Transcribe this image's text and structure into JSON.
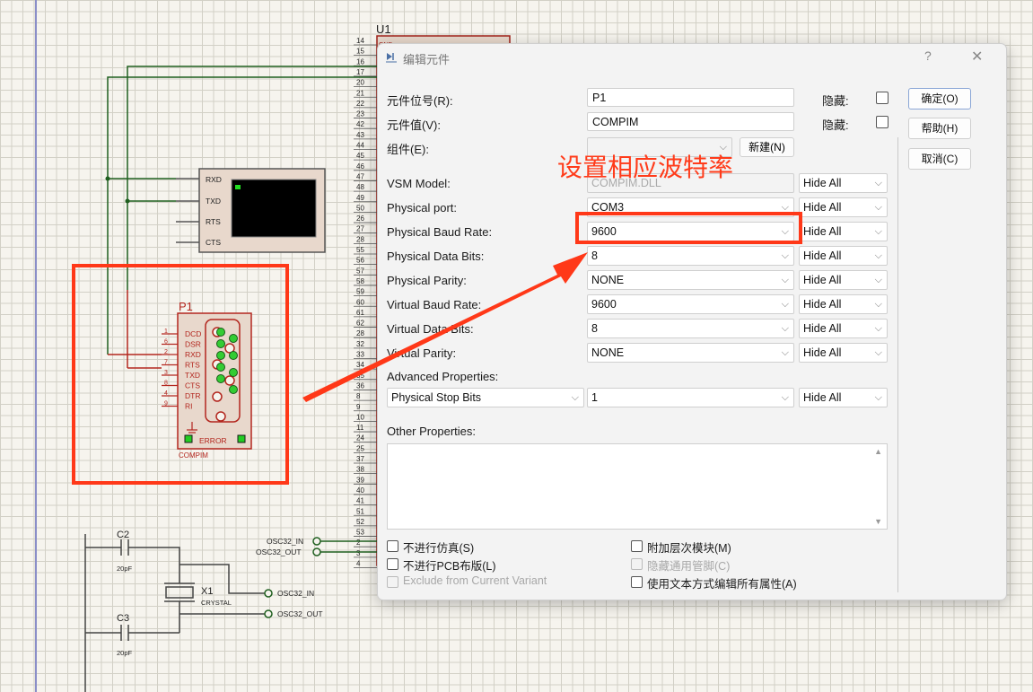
{
  "schematic": {
    "u1_label": "U1",
    "u1_pins": [
      "14",
      "15",
      "16",
      "17",
      "20",
      "21",
      "22",
      "23",
      "42",
      "43",
      "44",
      "45",
      "46",
      "47",
      "48",
      "49",
      "50",
      "26",
      "27",
      "28",
      "55",
      "56",
      "57",
      "58",
      "59",
      "60",
      "61",
      "62",
      "28",
      "32",
      "33",
      "34",
      "35",
      "36",
      "8",
      "9",
      "10",
      "11",
      "24",
      "25",
      "37",
      "38",
      "39",
      "40",
      "41",
      "51",
      "52",
      "53",
      "2",
      "3",
      "4"
    ],
    "u1_top_text": "GND",
    "terminal": {
      "pins": [
        "RXD",
        "TXD",
        "RTS",
        "CTS"
      ]
    },
    "compim": {
      "ref": "P1",
      "pin_nums": [
        "1",
        "6",
        "2",
        "7",
        "3",
        "8",
        "4",
        "9"
      ],
      "pins": [
        "DCD",
        "DSR",
        "RXD",
        "RTS",
        "TXD",
        "CTS",
        "DTR",
        "RI"
      ],
      "error_label": "ERROR",
      "value": "COMPIM"
    },
    "osc_in_label": "OSC32_IN",
    "osc_out_label": "OSC32_OUT",
    "c2": {
      "ref": "C2",
      "value": "20pF"
    },
    "c3": {
      "ref": "C3",
      "value": "20pF"
    },
    "x1": {
      "ref": "X1",
      "value": "CRYSTAL"
    },
    "osc_in_label2": "OSC32_IN",
    "osc_out_label2": "OSC32_OUT"
  },
  "annotation": {
    "text": "设置相应波特率",
    "color": "#ff3b1a"
  },
  "dialog": {
    "title": "编辑元件",
    "help_glyph": "?",
    "close_glyph": "✕",
    "part_ref": {
      "label": "元件位号(R):",
      "value": "P1",
      "hidden_label": "隐藏:",
      "hidden": false
    },
    "part_value": {
      "label": "元件值(V):",
      "value": "COMPIM",
      "hidden_label": "隐藏:",
      "hidden": false
    },
    "element": {
      "label": "组件(E):",
      "value": "",
      "new_button": "新建(N)"
    },
    "properties": [
      {
        "label": "VSM Model:",
        "value": "COMPIM.DLL",
        "visibility": "Hide All"
      },
      {
        "label": "Physical port:",
        "value": "COM3",
        "visibility": "Hide All"
      },
      {
        "label": "Physical Baud Rate:",
        "value": "9600",
        "visibility": "Hide All"
      },
      {
        "label": "Physical Data Bits:",
        "value": "8",
        "visibility": "Hide All"
      },
      {
        "label": "Physical Parity:",
        "value": "NONE",
        "visibility": "Hide All"
      },
      {
        "label": "Virtual Baud Rate:",
        "value": "9600",
        "visibility": "Hide All"
      },
      {
        "label": "Virtual Data Bits:",
        "value": "8",
        "visibility": "Hide All"
      },
      {
        "label": "Virtual Parity:",
        "value": "NONE",
        "visibility": "Hide All"
      }
    ],
    "advanced": {
      "label": "Advanced Properties:",
      "property": "Physical Stop Bits",
      "value": "1",
      "visibility": "Hide All"
    },
    "other_properties_label": "Other Properties:",
    "other_properties_value": "",
    "checkboxes_left": [
      {
        "label": "不进行仿真(S)",
        "checked": false,
        "disabled": false
      },
      {
        "label": "不进行PCB布版(L)",
        "checked": false,
        "disabled": false
      },
      {
        "label": "Exclude from Current Variant",
        "checked": false,
        "disabled": true
      }
    ],
    "checkboxes_right": [
      {
        "label": "附加层次模块(M)",
        "checked": false,
        "disabled": false
      },
      {
        "label": "隐藏通用管脚(C)",
        "checked": false,
        "disabled": true
      },
      {
        "label": "使用文本方式编辑所有属性(A)",
        "checked": false,
        "disabled": false
      }
    ],
    "buttons": {
      "ok": "确定(O)",
      "help": "帮助(H)",
      "cancel": "取消(C)"
    }
  },
  "colors": {
    "component_red": "#b3261e",
    "highlight": "#ff3818",
    "wire_green": "#1f5f1f"
  }
}
